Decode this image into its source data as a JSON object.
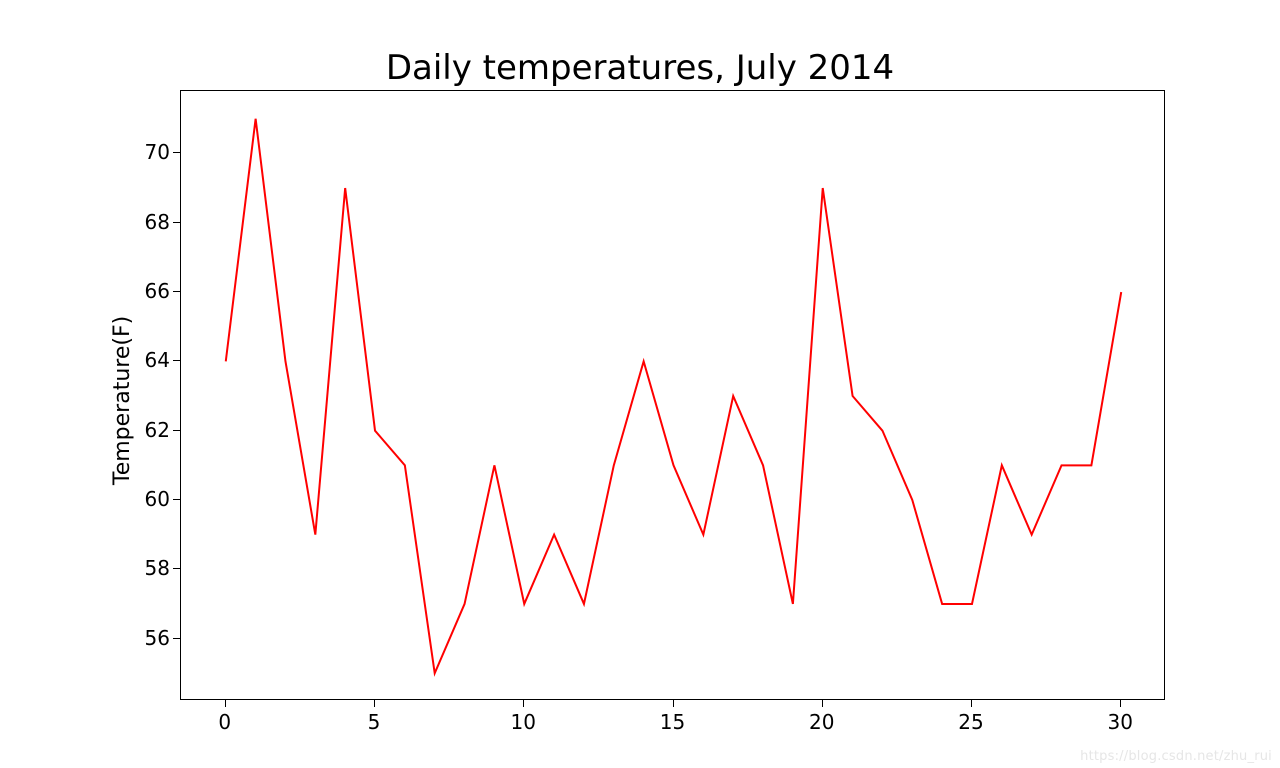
{
  "chart_data": {
    "type": "line",
    "title": "Daily temperatures, July 2014",
    "xlabel": "",
    "ylabel": "Temperature(F)",
    "x": [
      0,
      1,
      2,
      3,
      4,
      5,
      6,
      7,
      8,
      9,
      10,
      11,
      12,
      13,
      14,
      15,
      16,
      17,
      18,
      19,
      20,
      21,
      22,
      23,
      24,
      25,
      26,
      27,
      28,
      29,
      30
    ],
    "values": [
      64,
      71,
      64,
      59,
      69,
      62,
      61,
      55,
      57,
      61,
      57,
      59,
      57,
      61,
      64,
      61,
      59,
      63,
      61,
      57,
      69,
      63,
      62,
      60,
      57,
      57,
      61,
      59,
      61,
      61,
      66
    ],
    "xlim": [
      -1.5,
      31.5
    ],
    "ylim": [
      54.2,
      71.8
    ],
    "xticks": [
      0,
      5,
      10,
      15,
      20,
      25,
      30
    ],
    "yticks": [
      56,
      58,
      60,
      62,
      64,
      66,
      68,
      70
    ],
    "series_color": "#ff0000"
  },
  "watermark": "https://blog.csdn.net/zhu_rui"
}
